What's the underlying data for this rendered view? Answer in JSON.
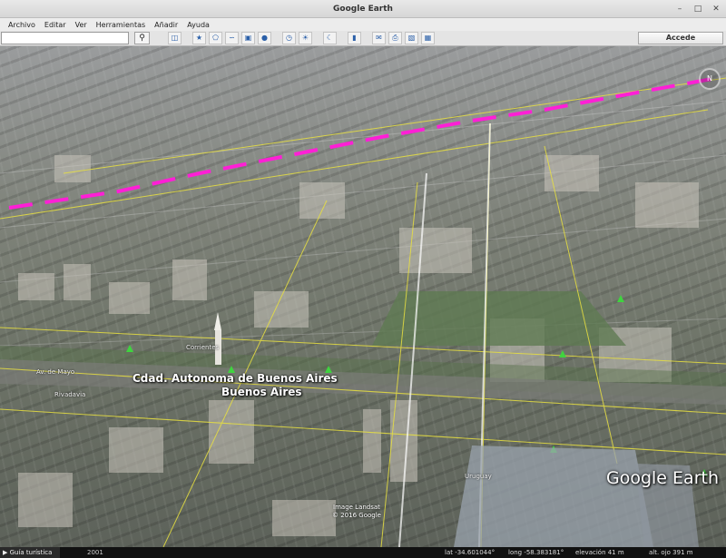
{
  "window": {
    "title": "Google Earth"
  },
  "menu": [
    {
      "label": "Archivo",
      "accel": "A"
    },
    {
      "label": "Editar",
      "accel": "E"
    },
    {
      "label": "Ver",
      "accel": "V"
    },
    {
      "label": "Herramientas",
      "accel": "H"
    },
    {
      "label": "Añadir",
      "accel": "A"
    },
    {
      "label": "Ayuda",
      "accel": "A"
    }
  ],
  "toolbar": {
    "search_value": "",
    "search_icon": "magnifier-icon",
    "buttons": [
      "sidebar-icon",
      "placemark-icon",
      "polygon-icon",
      "path-icon",
      "image-overlay-icon",
      "record-tour-icon",
      "historical-imagery-icon",
      "sunlight-icon",
      "planets-icon",
      "ruler-icon",
      "email-icon",
      "print-icon",
      "save-image-icon",
      "maps-icon"
    ],
    "signin_label": "Accede"
  },
  "map": {
    "places": [
      {
        "id": "caba",
        "name": "Cdad. Autonoma de Buenos Aires"
      },
      {
        "id": "ba",
        "name": "Buenos Aires"
      }
    ],
    "road_labels": [
      "Av. de Mayo",
      "Corrientes",
      "Rivadavia",
      "Uruguay"
    ],
    "attribution_line1": "Image Landsat",
    "attribution_line2": "© 2016 Google",
    "logo": "Google Earth"
  },
  "status": {
    "tour_guide": "Guía turística",
    "year": "2001",
    "lat": "lat  -34.601044°",
    "lon": "long  -58.383181°",
    "elevation": "elevación   41 m",
    "eye_alt": "alt. ojo   391 m"
  },
  "colors": {
    "path_line": "#ff1fd6",
    "road_lines": "#e8e040",
    "park_icon": "#3fd43f"
  }
}
